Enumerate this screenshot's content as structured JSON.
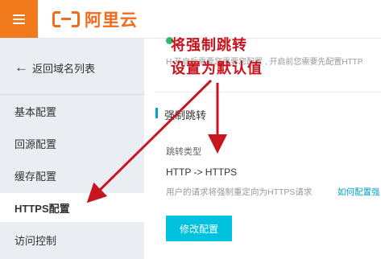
{
  "header": {
    "brand": "阿里云",
    "menu_icon": "hamburger-menu-icon",
    "logo_icon": "aliyun-logo-icon"
  },
  "sidebar": {
    "back_label": "返回域名列表",
    "items": [
      {
        "label": "基本配置",
        "active": false
      },
      {
        "label": "回源配置",
        "active": false
      },
      {
        "label": "缓存配置",
        "active": false
      },
      {
        "label": "HTTPS配置",
        "active": true
      },
      {
        "label": "访问控制",
        "active": false
      }
    ]
  },
  "main": {
    "hint_text": "H 开启后需要您需要您配置 , 开启前您需要先配置HTTP",
    "section_title": "强制跳转",
    "field_label": "跳转类型",
    "field_value": "HTTP -> HTTPS",
    "description": "用户的请求将强制重定向为HTTPS请求",
    "help_link": "如何配置强",
    "modify_button": "修改配置"
  },
  "annotation": {
    "line1": "将强制跳转",
    "line2": "设置为默认值"
  },
  "colors": {
    "brand_orange": "#f17a1d",
    "accent_cyan": "#00c1de",
    "link_blue": "#00a2ca",
    "annotation_red": "#c8141e",
    "status_green": "#2eb86b",
    "sidebar_bg": "#eaedf1"
  }
}
